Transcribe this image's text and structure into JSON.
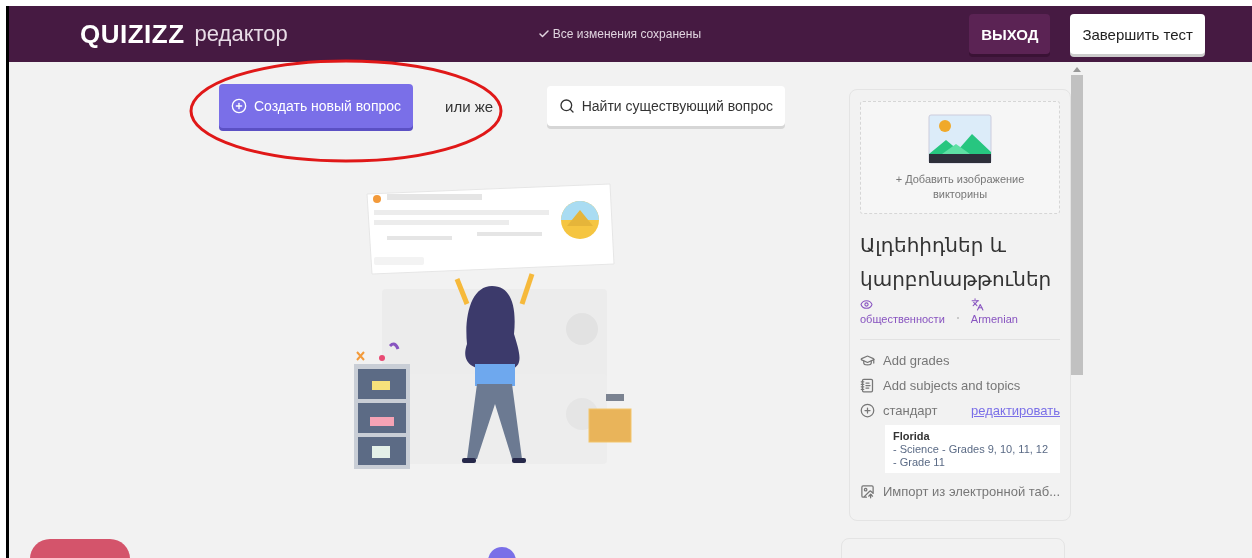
{
  "header": {
    "logo": "QUIZIZZ",
    "subtitle": "редактор",
    "save_status": "Все изменения сохранены",
    "buttons": [
      {
        "label": "ВЫХОД",
        "kind": "dark"
      },
      {
        "label": "Завершить тест",
        "kind": "light"
      }
    ]
  },
  "actions": {
    "create": "Создать новый вопрос",
    "separator": "или же",
    "search": "Найти существующий вопрос"
  },
  "quiz_panel": {
    "add_image": "+ Добавить изображение викторины",
    "title": "Ալդեհիդներ և կարբոնաթթուներ",
    "visibility": "общественности",
    "language": "Armenian",
    "settings": [
      {
        "kind": "grades",
        "label": "Add grades"
      },
      {
        "kind": "subjects",
        "label": "Add subjects and topics"
      },
      {
        "kind": "standard",
        "label": "стандарт",
        "link": "редактировать"
      }
    ],
    "standard": {
      "state": "Florida",
      "lines": [
        "- Science - Grades 9, 10, 11, 12",
        "- Grade 11"
      ]
    },
    "import": "Импорт из электронной таб..."
  }
}
